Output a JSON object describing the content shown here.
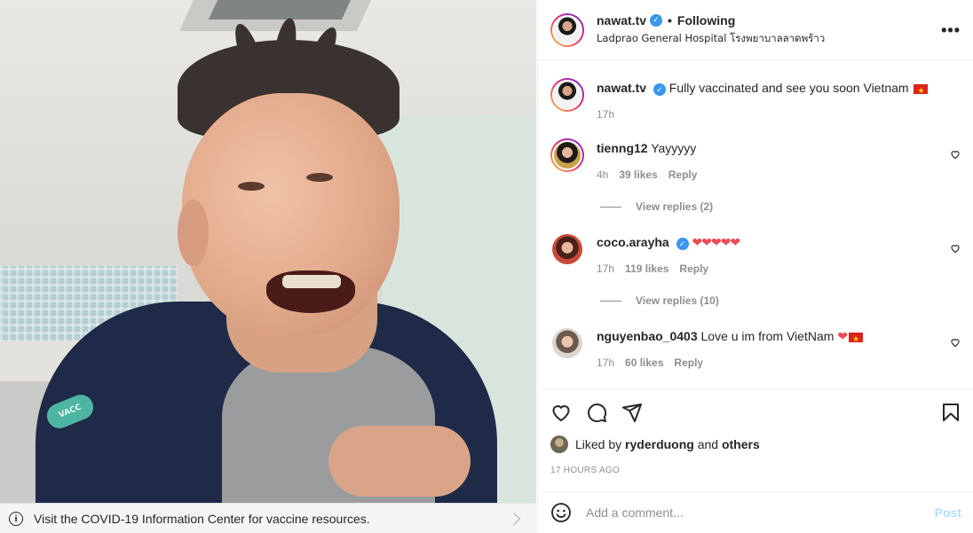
{
  "covid_bar": {
    "text": "Visit the COVID-19 Information Center for vaccine resources."
  },
  "header": {
    "username": "nawat.tv",
    "separator": "•",
    "follow_status": "Following",
    "location": "Ladprao General Hospital โรงพยาบาลลาดพร้าว",
    "more": "•••"
  },
  "caption": {
    "username": "nawat.tv",
    "text": "Fully vaccinated and see you soon Vietnam",
    "time": "17h"
  },
  "comments": [
    {
      "username": "tienng12",
      "text": "Yayyyyy",
      "time": "4h",
      "likes": "39 likes",
      "reply": "Reply",
      "view_replies": "View replies (2)"
    },
    {
      "username": "coco.arayha",
      "text": "❤❤❤❤❤",
      "time": "17h",
      "likes": "119 likes",
      "reply": "Reply",
      "view_replies": "View replies (10)"
    },
    {
      "username": "nguyenbao_0403",
      "text": "Love u im from VietNam",
      "text_hearts": "❤",
      "time": "17h",
      "likes": "60 likes",
      "reply": "Reply"
    }
  ],
  "likes": {
    "prefix": "Liked by",
    "user": "ryderduong",
    "and": "and",
    "others": "others"
  },
  "post_age": "17 HOURS AGO",
  "add_comment": {
    "placeholder": "Add a comment...",
    "post_label": "Post"
  },
  "photo": {
    "bandage_text": "VACC"
  },
  "colors": {
    "verified": "#3897f0",
    "post_disabled": "#b2dffc",
    "heart_red": "#ed4956"
  }
}
